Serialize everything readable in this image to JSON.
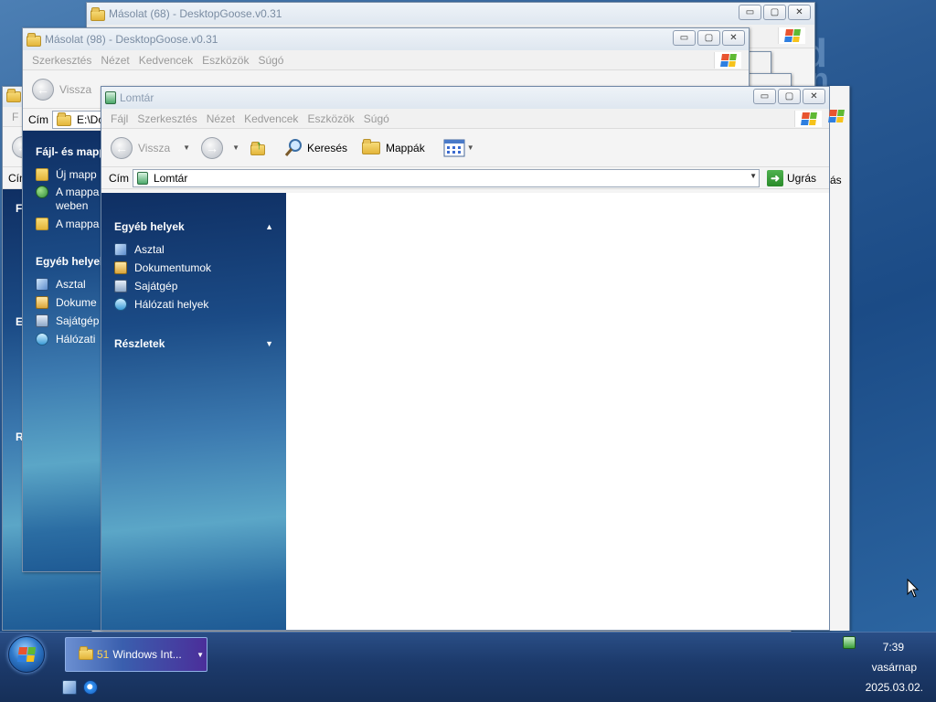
{
  "desktop": {
    "accent": "#2a5a93"
  },
  "windows": {
    "back1": {
      "title": "Másolat (68) - DesktopGoose.v0.31",
      "buttons": [
        "▭",
        "▢",
        "✕"
      ]
    },
    "back2": {
      "title": "Másolat (98) - DesktopGoose.v0.31",
      "menu": [
        "Szerkesztés",
        "Nézet",
        "Kedvencek",
        "Eszközök",
        "Súgó"
      ],
      "back_label": "Vissza",
      "taskpane": {
        "section1_title": "Fájl- és mapp",
        "section1_items": [
          "Új mapp",
          "A mappa weben",
          "A mappa"
        ],
        "section2_title": "Egyéb helyek",
        "section2_items": [
          "Asztal",
          "Dokume",
          "Sajátgép",
          "Hálózati"
        ]
      }
    },
    "back3": {
      "addr_label": "Cím",
      "addr_value": "E:\\Do",
      "letters": [
        "F",
        "E",
        "R"
      ]
    },
    "main": {
      "title": "Lomtár",
      "menu": [
        "Fájl",
        "Szerkesztés",
        "Nézet",
        "Kedvencek",
        "Eszközök",
        "Súgó"
      ],
      "toolbar": {
        "back": "Vissza",
        "search": "Keresés",
        "folders": "Mappák"
      },
      "address": {
        "label": "Cím",
        "value": "Lomtár",
        "go": "Ugrás",
        "overflow": "ás"
      },
      "taskpane": {
        "other_places_title": "Egyéb helyek",
        "other_places": [
          {
            "label": "Asztal",
            "icon": "desktop-icon"
          },
          {
            "label": "Dokumentumok",
            "icon": "documents-icon"
          },
          {
            "label": "Sajátgép",
            "icon": "my-computer-icon"
          },
          {
            "label": "Hálózati helyek",
            "icon": "network-places-icon"
          }
        ],
        "details_title": "Részletek"
      }
    }
  },
  "taskbar": {
    "group_count": "51",
    "group_label": "Windows Int...",
    "time": "7:39",
    "day": "vasárnap",
    "date": "2025.03.02."
  }
}
